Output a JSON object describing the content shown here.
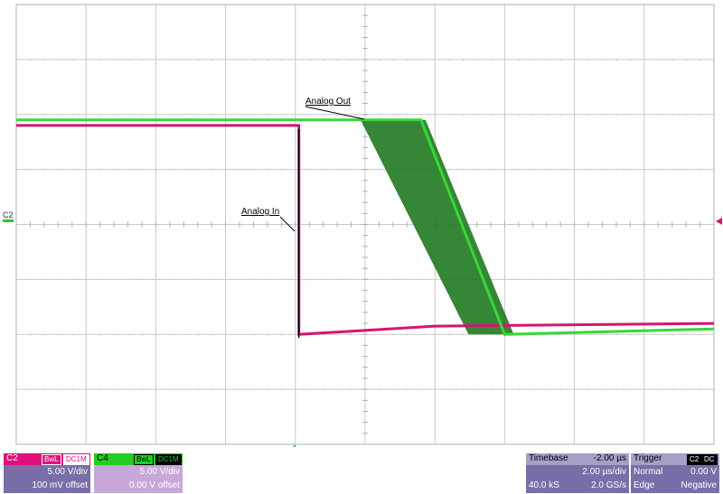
{
  "screen": {
    "labels": {
      "analog_out": "Analog Out",
      "analog_in": "Analog In",
      "c2_marker": "C2"
    },
    "colors": {
      "ch2": "#e0107a",
      "ch4": "#22cc22",
      "grid": "#c0c0c0",
      "panel": "#7a6ea8"
    }
  },
  "chart_data": {
    "type": "line",
    "title": "",
    "xlabel": "",
    "ylabel": "",
    "grid": true,
    "divisions": {
      "x": 10,
      "y": 8
    },
    "series": [
      {
        "name": "Analog Out",
        "channel": "C4",
        "x_div": [
          0,
          5.0,
          5.8,
          7.0,
          10
        ],
        "y_div": [
          1.9,
          1.9,
          1.9,
          -2.0,
          -1.9
        ]
      },
      {
        "name": "Analog In",
        "channel": "C2",
        "x_div": [
          0,
          4.05,
          4.05,
          6.0,
          10
        ],
        "y_div": [
          1.8,
          1.8,
          -2.0,
          -1.85,
          -1.8
        ]
      }
    ]
  },
  "panels": {
    "c2": {
      "name": "C2",
      "tag1": "BwL",
      "tag2": "DC1M",
      "scale": "5.00 V/div",
      "offset": "100 mV offset"
    },
    "c4": {
      "name": "C4",
      "tag1": "BwL",
      "tag2": "DC1M",
      "scale": "5.00 V/div",
      "offset": "0.00 V offset"
    },
    "timebase": {
      "title": "Timebase",
      "delay": "-2.00 µs",
      "scale": "2.00 µs/div",
      "samples": "40.0 kS",
      "rate": "2.0 GS/s"
    },
    "trigger": {
      "title": "Trigger",
      "source": "C2",
      "coupling": "DC",
      "mode": "Normal",
      "level": "0.00 V",
      "type": "Edge",
      "slope": "Negative"
    }
  }
}
